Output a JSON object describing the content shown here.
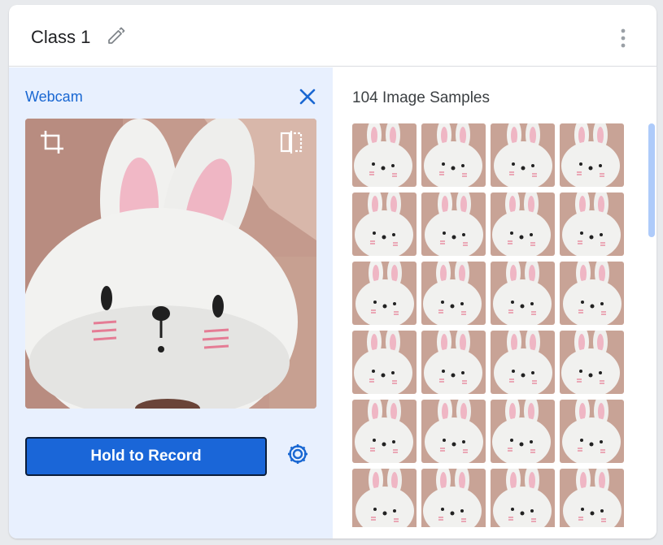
{
  "header": {
    "class_name": "Class 1",
    "edit_icon": "pencil-icon",
    "menu_icon": "more-vertical-icon"
  },
  "webcam": {
    "label": "Webcam",
    "close_icon": "close-icon",
    "crop_icon": "crop-icon",
    "flip_icon": "flip-horizontal-icon",
    "record_label": "Hold to Record",
    "settings_icon": "gear-icon"
  },
  "samples": {
    "title": "104 Image Samples",
    "visible_thumbnail_count": 24
  },
  "colors": {
    "accent": "#1967d2",
    "button": "#1a66d8",
    "panel_bg": "#e8f0fe",
    "scrollbar": "#aecbfa"
  }
}
